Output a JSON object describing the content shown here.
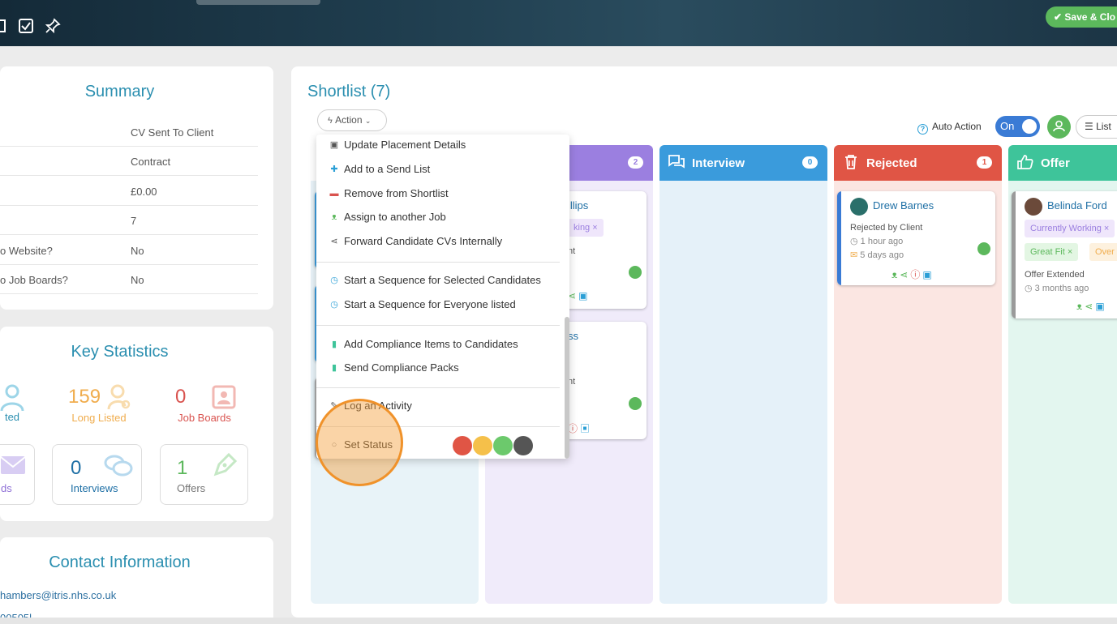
{
  "toolbar": {
    "save_label": "Save & Clo"
  },
  "summary": {
    "title": "Summary",
    "rows": [
      {
        "key": "",
        "value": "CV Sent To Client"
      },
      {
        "key": "",
        "value": "Contract"
      },
      {
        "key": "",
        "value": "£0.00"
      },
      {
        "key": "",
        "value": "7"
      },
      {
        "key": "o Website?",
        "value": "No"
      },
      {
        "key": "o Job Boards?",
        "value": "No"
      }
    ]
  },
  "stats": {
    "title": "Key Statistics",
    "items": [
      {
        "num": "",
        "label": "ted",
        "color": "#2b8fb0"
      },
      {
        "num": "159",
        "label": "Long Listed",
        "color": "#f0ad4e"
      },
      {
        "num": "0",
        "label": "Job Boards",
        "color": "#d9534f"
      }
    ],
    "boxes": [
      {
        "num": "",
        "label": "ds",
        "color": "#8e6fd6"
      },
      {
        "num": "0",
        "label": "Interviews",
        "color": "#1e6fa5"
      },
      {
        "num": "1",
        "label": "Offers",
        "color": "#5cb85c"
      }
    ]
  },
  "contact": {
    "title": "Contact Information",
    "email": "hambers@itris.nhs.co.uk",
    "phone": "00505l"
  },
  "shortlist": {
    "title": "Shortlist (7)",
    "action_label": "Action",
    "auto_action_label": "Auto Action",
    "toggle_label": "On",
    "list_label": "List"
  },
  "columns": [
    {
      "title": "",
      "count": "",
      "color": "#3a9bdc",
      "bg": "#e8f3f8"
    },
    {
      "title": "",
      "count": "2",
      "color": "#9b7fe0",
      "bg": "#f0ebfa"
    },
    {
      "title": "Interview",
      "count": "0",
      "color": "#3a9bdc",
      "bg": "#e5f1f9"
    },
    {
      "title": "Rejected",
      "count": "1",
      "color": "#e05545",
      "bg": "#fbe6e2"
    },
    {
      "title": "Offer",
      "count": "",
      "color": "#3ec49a",
      "bg": "#e3f6ef"
    }
  ],
  "cards": {
    "phillips": {
      "name": "illips",
      "badge": "king",
      "line": "nt"
    },
    "ss": {
      "name": "ss",
      "line": "nt"
    },
    "drew": {
      "name": "Drew Barnes",
      "status": "Rejected by Client",
      "time1": "1 hour ago",
      "time2": "5 days ago"
    },
    "belinda": {
      "name": "Belinda Ford",
      "badge1": "Currently Working",
      "badge2": "Great Fit",
      "badge3": "Over",
      "status": "Offer Extended",
      "time": "3 months ago"
    }
  },
  "menu": {
    "items": [
      {
        "label": "Update Placement Details",
        "icon": "briefcase-icon"
      },
      {
        "label": "Add to a Send List",
        "icon": "user-plus-icon"
      },
      {
        "label": "Remove from Shortlist",
        "icon": "user-minus-icon"
      },
      {
        "label": "Assign to another Job",
        "icon": "users-icon"
      },
      {
        "label": "Forward Candidate CVs Internally",
        "icon": "share-icon"
      },
      {
        "label": "Start a Sequence for Selected Candidates",
        "icon": "alarm-icon"
      },
      {
        "label": "Start a Sequence for Everyone listed",
        "icon": "alarm-icon"
      },
      {
        "label": "Add Compliance Items to Candidates",
        "icon": "clipboard-icon"
      },
      {
        "label": "Send Compliance Packs",
        "icon": "clipboard-icon"
      },
      {
        "label": "Log an Activity",
        "icon": "edit-icon"
      },
      {
        "label": "Set Status",
        "icon": "circle-icon"
      }
    ],
    "status_colors": [
      "#e05545",
      "#f5c04a",
      "#6cc96c",
      "#555555"
    ]
  }
}
